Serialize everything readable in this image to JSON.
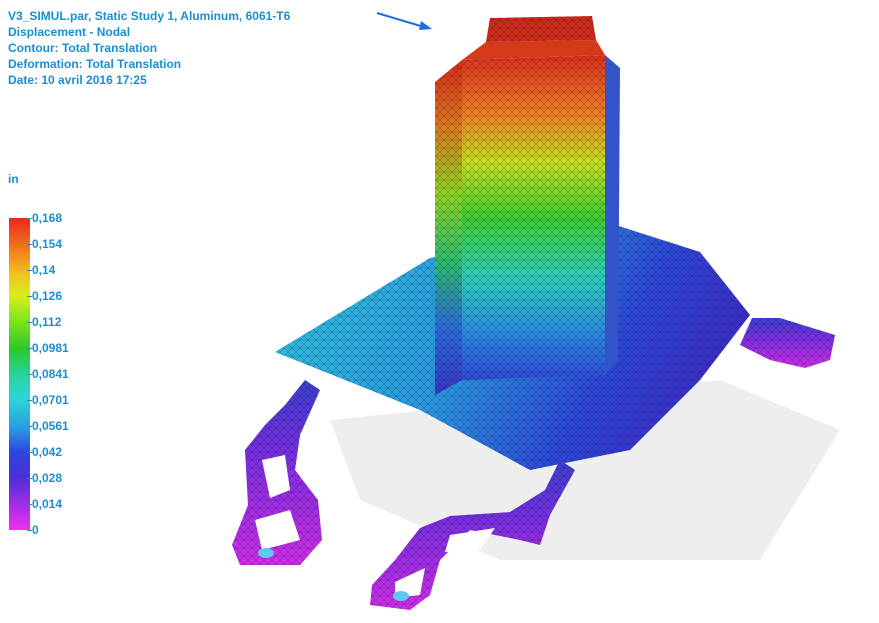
{
  "header": {
    "line1": "V3_SIMUL.par, Static Study 1, Aluminum, 6061-T6",
    "line2": "Displacement - Nodal",
    "line3": "Contour: Total Translation",
    "line4": "Deformation: Total Translation",
    "line5": "Date: 10 avril 2016  17:25"
  },
  "legend": {
    "unit": "in",
    "ticks": [
      "0,168",
      "0,154",
      "0,14",
      "0,126",
      "0,112",
      "0,0981",
      "0,0841",
      "0,0701",
      "0,0561",
      "0,042",
      "0,028",
      "0,014",
      "0"
    ],
    "colors": [
      "#e8281e",
      "#f47a1c",
      "#f2c31f",
      "#d9ec1c",
      "#7fe41f",
      "#2ec82a",
      "#27d39a",
      "#2bd6d8",
      "#2a9ee2",
      "#2d46e0",
      "#4a2fd6",
      "#9a2de4",
      "#f02ff0"
    ]
  },
  "icons": {
    "orientation": "direction-arrow-icon"
  }
}
